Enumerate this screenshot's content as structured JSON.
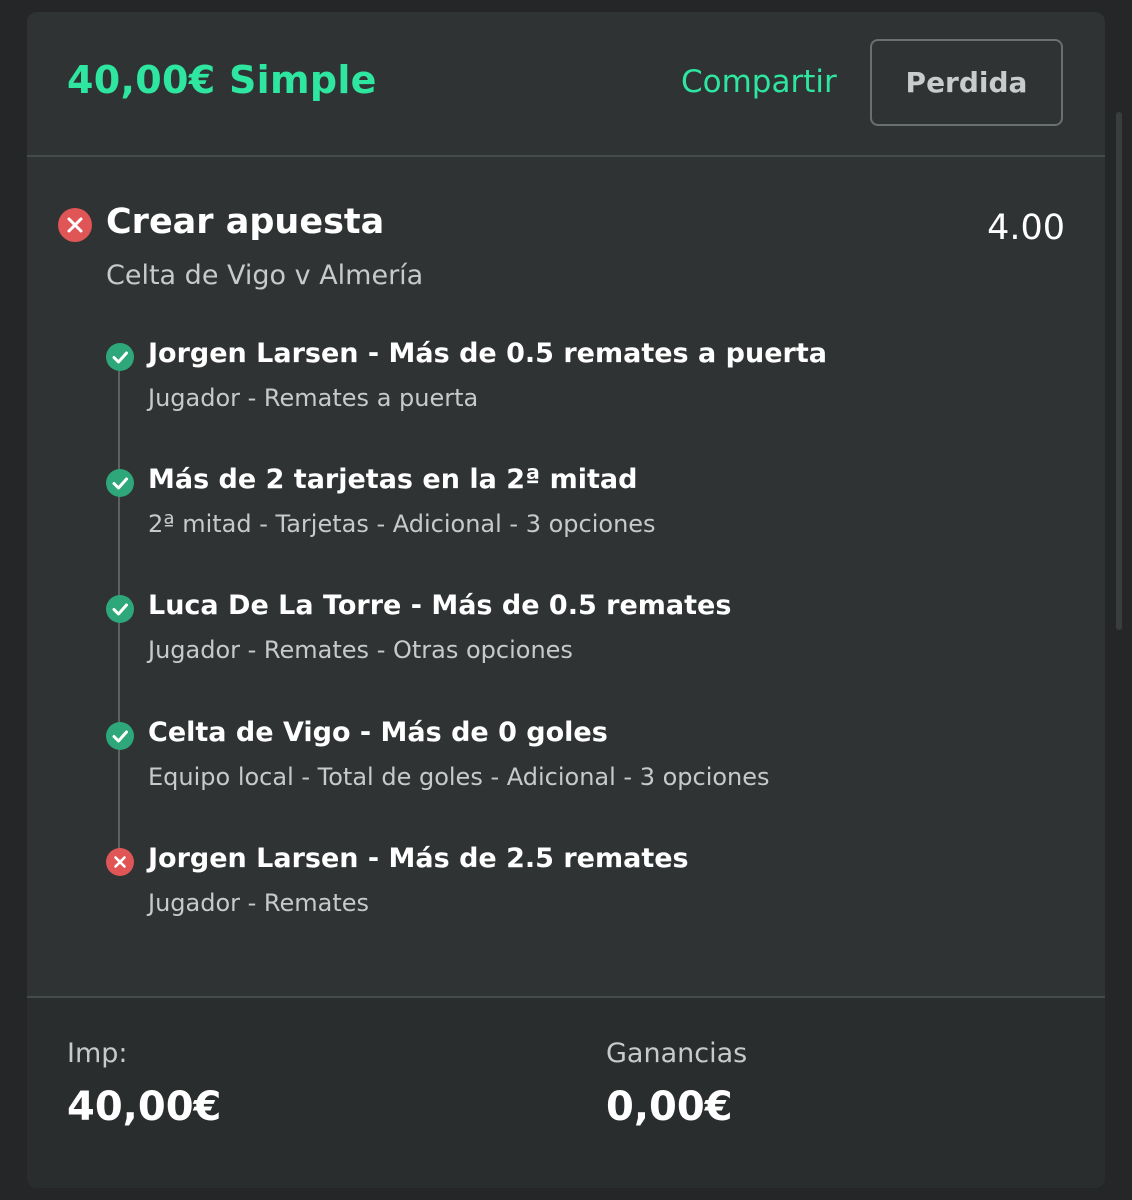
{
  "header": {
    "title": "40,00€ Simple",
    "share_label": "Compartir",
    "status_label": "Perdida"
  },
  "bet": {
    "title": "Crear apuesta",
    "odds": "4.00",
    "match": "Celta de Vigo v Almería",
    "status": "lost"
  },
  "selections": [
    {
      "title": "Jorgen Larsen - Más de 0.5 remates a puerta",
      "subtitle": "Jugador - Remates a puerta",
      "result": "won"
    },
    {
      "title": "Más de 2 tarjetas en la 2ª mitad",
      "subtitle": "2ª mitad - Tarjetas - Adicional - 3 opciones",
      "result": "won"
    },
    {
      "title": "Luca De La Torre - Más de 0.5 remates",
      "subtitle": "Jugador - Remates - Otras opciones",
      "result": "won"
    },
    {
      "title": "Celta de Vigo - Más de 0 goles",
      "subtitle": "Equipo local - Total de goles - Adicional - 3 opciones",
      "result": "won"
    },
    {
      "title": "Jorgen Larsen - Más de 2.5 remates",
      "subtitle": "Jugador - Remates",
      "result": "lost"
    }
  ],
  "footer": {
    "stake_label": "Imp:",
    "stake_value": "40,00€",
    "returns_label": "Ganancias",
    "returns_value": "0,00€"
  },
  "colors": {
    "accent": "#2ee6a0",
    "won": "#2ea77a",
    "lost": "#e05656"
  },
  "icons": {
    "won": "check-circle-icon",
    "lost": "x-circle-icon"
  }
}
